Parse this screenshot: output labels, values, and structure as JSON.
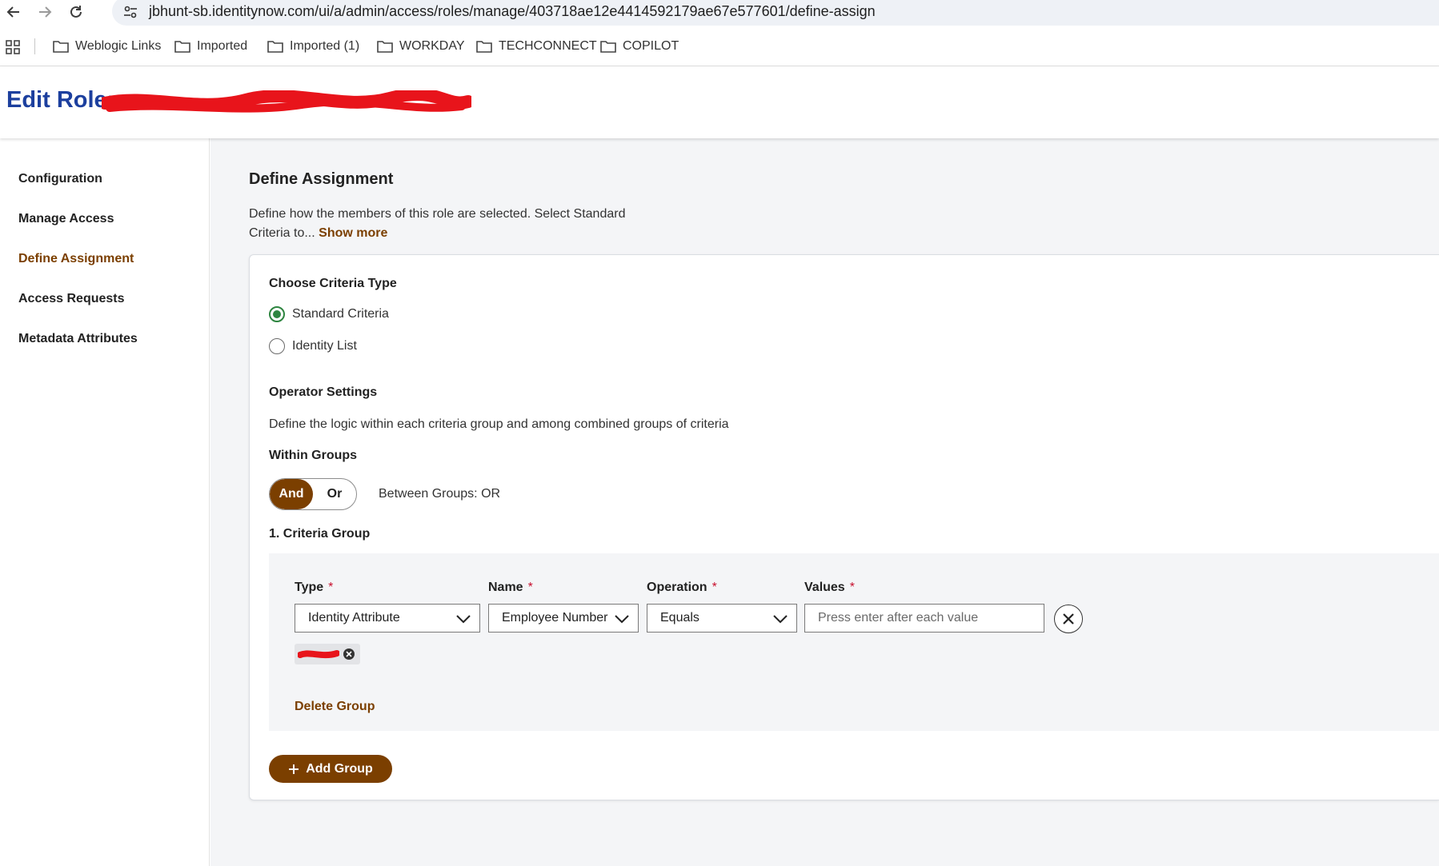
{
  "browser": {
    "url": "jbhunt-sb.identitynow.com/ui/a/admin/access/roles/manage/403718ae12e4414592179ae67e577601/define-assign",
    "bookmarks": [
      "Weblogic Links",
      "Imported",
      "Imported (1)",
      "WORKDAY",
      "TECHCONNECT",
      "COPILOT"
    ]
  },
  "header": {
    "title_prefix": "Edit Role:"
  },
  "sidebar": {
    "items": [
      {
        "label": "Configuration",
        "active": false
      },
      {
        "label": "Manage Access",
        "active": false
      },
      {
        "label": "Define Assignment",
        "active": true
      },
      {
        "label": "Access Requests",
        "active": false
      },
      {
        "label": "Metadata Attributes",
        "active": false
      }
    ]
  },
  "main": {
    "title": "Define Assignment",
    "description": "Define how the members of this role are selected. Select Standard Criteria to...",
    "show_more": "Show more",
    "criteria_type": {
      "label": "Choose Criteria Type",
      "options": [
        {
          "label": "Standard Criteria",
          "checked": true
        },
        {
          "label": "Identity List",
          "checked": false
        }
      ]
    },
    "operator": {
      "label": "Operator Settings",
      "description": "Define the logic within each criteria group and among combined groups of criteria",
      "within_label": "Within Groups",
      "toggle": {
        "and": "And",
        "or": "Or",
        "selected": "And"
      },
      "between": "Between Groups: OR"
    },
    "group": {
      "title": "1. Criteria Group",
      "fields": {
        "type_label": "Type",
        "name_label": "Name",
        "operation_label": "Operation",
        "values_label": "Values",
        "required_mark": "*",
        "type_value": "Identity Attribute",
        "name_value": "Employee Number",
        "operation_value": "Equals",
        "values_placeholder": "Press enter after each value"
      },
      "delete_label": "Delete Group"
    },
    "add_group_label": "Add Group"
  },
  "colors": {
    "brand_brown": "#7b3f00",
    "title_blue": "#1c3f9e",
    "radio_green": "#2e8540",
    "required_red": "#c8102e",
    "redaction_red": "#e8141b"
  }
}
